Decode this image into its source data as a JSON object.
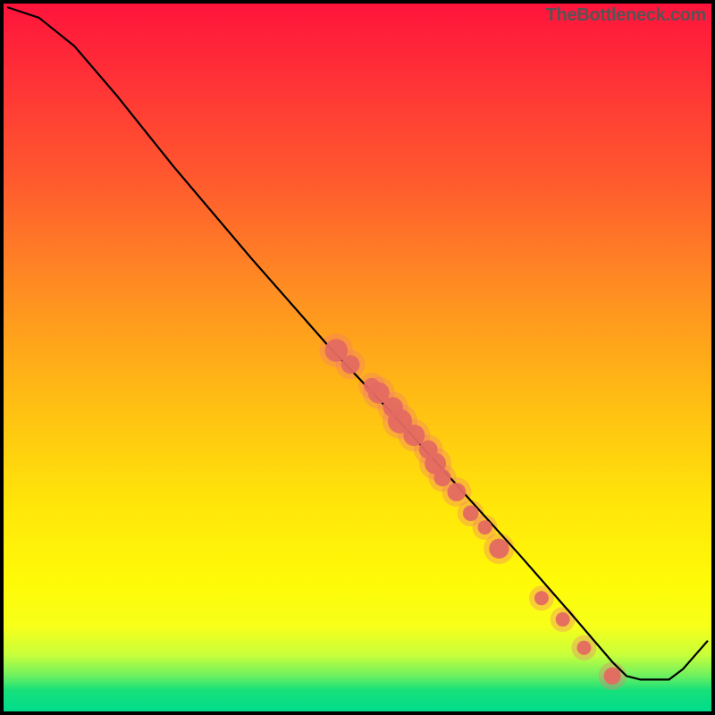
{
  "watermark": "TheBottleneck.com",
  "chart_data": {
    "type": "line",
    "title": "",
    "xlabel": "",
    "ylabel": "",
    "xlim": [
      0,
      100
    ],
    "ylim": [
      0,
      100
    ],
    "grid": false,
    "legend": false,
    "series": [
      {
        "name": "curve",
        "type": "line",
        "points": [
          {
            "x": 0.5,
            "y": 99.5
          },
          {
            "x": 5,
            "y": 98.0
          },
          {
            "x": 10,
            "y": 94.0
          },
          {
            "x": 16,
            "y": 87.0
          },
          {
            "x": 24,
            "y": 77.0
          },
          {
            "x": 35,
            "y": 64.0
          },
          {
            "x": 46,
            "y": 51.5
          },
          {
            "x": 55,
            "y": 42.0
          },
          {
            "x": 64,
            "y": 32.0
          },
          {
            "x": 73,
            "y": 22.0
          },
          {
            "x": 80,
            "y": 14.0
          },
          {
            "x": 86,
            "y": 7.0
          },
          {
            "x": 88,
            "y": 5.0
          },
          {
            "x": 90,
            "y": 4.5
          },
          {
            "x": 94,
            "y": 4.5
          },
          {
            "x": 96,
            "y": 6.0
          },
          {
            "x": 99.5,
            "y": 10.0
          }
        ]
      },
      {
        "name": "highlighted-points",
        "type": "scatter",
        "points": [
          {
            "x": 47,
            "y": 51,
            "r": 1.6
          },
          {
            "x": 49,
            "y": 49,
            "r": 1.3
          },
          {
            "x": 52,
            "y": 46,
            "r": 1.1
          },
          {
            "x": 53,
            "y": 45,
            "r": 1.5
          },
          {
            "x": 55,
            "y": 43,
            "r": 1.4
          },
          {
            "x": 56,
            "y": 41,
            "r": 1.7
          },
          {
            "x": 58,
            "y": 39,
            "r": 1.5
          },
          {
            "x": 60,
            "y": 37,
            "r": 1.3
          },
          {
            "x": 61,
            "y": 35,
            "r": 1.5
          },
          {
            "x": 62,
            "y": 33,
            "r": 1.2
          },
          {
            "x": 64,
            "y": 31,
            "r": 1.3
          },
          {
            "x": 66,
            "y": 28,
            "r": 1.1
          },
          {
            "x": 68,
            "y": 26,
            "r": 1.0
          },
          {
            "x": 70,
            "y": 23,
            "r": 1.4
          },
          {
            "x": 76,
            "y": 16,
            "r": 1.0
          },
          {
            "x": 79,
            "y": 13,
            "r": 1.0
          },
          {
            "x": 82,
            "y": 9,
            "r": 1.0
          },
          {
            "x": 86,
            "y": 5,
            "r": 1.2
          }
        ]
      }
    ],
    "background_gradient_stops": [
      {
        "pct": 0,
        "color": "#ff143c"
      },
      {
        "pct": 55,
        "color": "#ffba14"
      },
      {
        "pct": 82,
        "color": "#fffb08"
      },
      {
        "pct": 97,
        "color": "#17e07a"
      },
      {
        "pct": 100,
        "color": "#00dc8c"
      }
    ]
  }
}
